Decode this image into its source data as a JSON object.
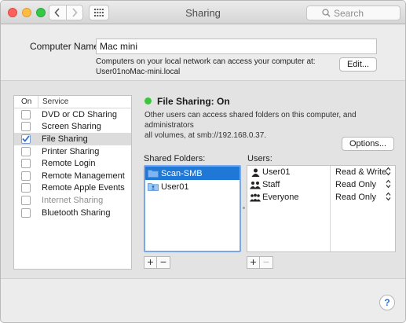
{
  "window": {
    "title": "Sharing",
    "search_placeholder": "Search"
  },
  "computer": {
    "label": "Computer Name:",
    "name": "Mac mini",
    "desc_line1": "Computers on your local network can access your computer at:",
    "desc_line2": "User01noMac-mini.local",
    "edit_label": "Edit..."
  },
  "services": {
    "header_on": "On",
    "header_service": "Service",
    "items": [
      {
        "label": "DVD or CD Sharing",
        "checked": false,
        "selected": false,
        "disabled": false
      },
      {
        "label": "Screen Sharing",
        "checked": false,
        "selected": false,
        "disabled": false
      },
      {
        "label": "File Sharing",
        "checked": true,
        "selected": true,
        "disabled": false
      },
      {
        "label": "Printer Sharing",
        "checked": false,
        "selected": false,
        "disabled": false
      },
      {
        "label": "Remote Login",
        "checked": false,
        "selected": false,
        "disabled": false
      },
      {
        "label": "Remote Management",
        "checked": false,
        "selected": false,
        "disabled": false
      },
      {
        "label": "Remote Apple Events",
        "checked": false,
        "selected": false,
        "disabled": false
      },
      {
        "label": "Internet Sharing",
        "checked": false,
        "selected": false,
        "disabled": true
      },
      {
        "label": "Bluetooth Sharing",
        "checked": false,
        "selected": false,
        "disabled": false
      }
    ]
  },
  "status": {
    "label": "File Sharing: On",
    "color": "#3cc63c",
    "desc_line1": "Other users can access shared folders on this computer, and administrators",
    "desc_line2": "all volumes, at smb://192.168.0.37.",
    "options_label": "Options..."
  },
  "shared_folders": {
    "label": "Shared Folders:",
    "items": [
      {
        "name": "Scan-SMB",
        "icon": "folder-icon",
        "selected": true
      },
      {
        "name": "User01",
        "icon": "user-folder-icon",
        "selected": false
      }
    ]
  },
  "users": {
    "label": "Users:",
    "items": [
      {
        "name": "User01",
        "icon": "single-user-icon",
        "permission": "Read & Write"
      },
      {
        "name": "Staff",
        "icon": "group-icon",
        "permission": "Read Only"
      },
      {
        "name": "Everyone",
        "icon": "everyone-icon",
        "permission": "Read Only"
      }
    ]
  },
  "buttons": {
    "add": "+",
    "remove": "−",
    "help": "?"
  },
  "colors": {
    "selection": "#1f78d6",
    "checkmark": "#2f6fd6"
  }
}
